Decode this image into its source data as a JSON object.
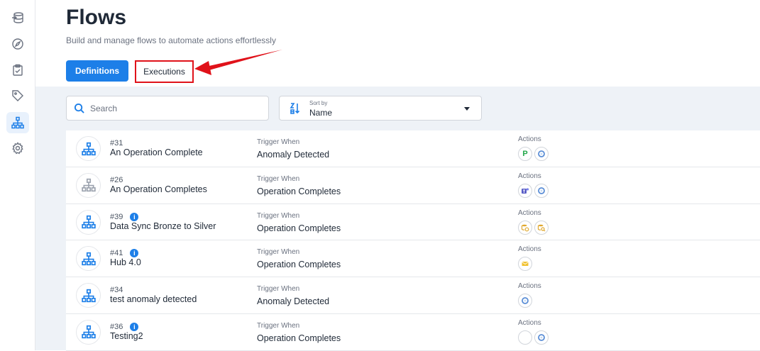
{
  "header": {
    "title": "Flows",
    "subtitle": "Build and manage flows to automate actions effortlessly"
  },
  "tabs": {
    "definitions": "Definitions",
    "executions": "Executions"
  },
  "search": {
    "placeholder": "Search"
  },
  "sort": {
    "label": "Sort by",
    "value": "Name"
  },
  "flows": [
    {
      "id": "#31",
      "name": "An Operation Complete",
      "trigger_label": "Trigger When",
      "trigger": "Anomaly Detected",
      "actions_label": "Actions",
      "info": false,
      "inactive": false,
      "actions": [
        "pagerduty-icon",
        "qualytics-icon"
      ]
    },
    {
      "id": "#26",
      "name": "An Operation Completes",
      "trigger_label": "Trigger When",
      "trigger": "Operation Completes",
      "actions_label": "Actions",
      "info": false,
      "inactive": true,
      "actions": [
        "teams-icon",
        "qualytics-icon"
      ]
    },
    {
      "id": "#39",
      "name": "Data Sync Bronze to Silver",
      "trigger_label": "Trigger When",
      "trigger": "Operation Completes",
      "actions_label": "Actions",
      "info": true,
      "inactive": false,
      "actions": [
        "datastore-sync-icon",
        "datastore-search-icon"
      ]
    },
    {
      "id": "#41",
      "name": "Hub 4.0",
      "trigger_label": "Trigger When",
      "trigger": "Operation Completes",
      "actions_label": "Actions",
      "info": true,
      "inactive": false,
      "actions": [
        "email-icon"
      ]
    },
    {
      "id": "#34",
      "name": "test anomaly detected",
      "trigger_label": "Trigger When",
      "trigger": "Anomaly Detected",
      "actions_label": "Actions",
      "info": false,
      "inactive": false,
      "actions": [
        "qualytics-icon"
      ]
    },
    {
      "id": "#36",
      "name": "Testing2",
      "trigger_label": "Trigger When",
      "trigger": "Operation Completes",
      "actions_label": "Actions",
      "info": true,
      "inactive": false,
      "actions": [
        "empty-action-icon",
        "qualytics-icon"
      ]
    }
  ],
  "colors": {
    "primary": "#1d7fe8",
    "highlight": "#e0121a",
    "content_bg": "#eef2f7"
  },
  "sidebar": {
    "icons": [
      "source-datastores-icon",
      "explore-icon",
      "checklist-icon",
      "tags-icon",
      "flows-icon",
      "settings-icon"
    ],
    "active": "flows-icon"
  }
}
